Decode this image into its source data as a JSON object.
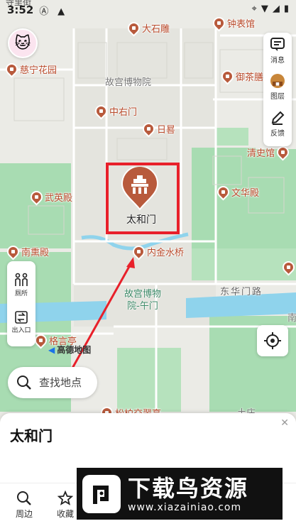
{
  "status_bar": {
    "time": "3:52",
    "cut_text": "寺里街"
  },
  "map": {
    "pois": [
      {
        "name": "大石雕",
        "id": "poi-dashidiao"
      },
      {
        "name": "钟表馆",
        "id": "poi-zhongbiaoguan"
      },
      {
        "name": "慈宁花园",
        "id": "poi-ciningguyuan"
      },
      {
        "name": "御茶膳房",
        "id": "poi-yuchashanfang"
      },
      {
        "name": "中右门",
        "id": "poi-zhongyoumen"
      },
      {
        "name": "日晷",
        "id": "poi-rigui"
      },
      {
        "name": "清史馆",
        "id": "poi-qingshiguan"
      },
      {
        "name": "武英殿",
        "id": "poi-wuyingdian"
      },
      {
        "name": "文华殿",
        "id": "poi-wenhuadian"
      },
      {
        "name": "南熏殿",
        "id": "poi-nanxundian"
      },
      {
        "name": "内金水桥",
        "id": "poi-neijinshuiqiao"
      },
      {
        "name": "格言亭",
        "id": "poi-geyanting"
      },
      {
        "name": "松柏交翠亭",
        "id": "poi-songbai"
      }
    ],
    "area_labels": {
      "museum_top": "故宫博物院",
      "museum_gate_line1": "故宫博物",
      "museum_gate_line2": "院-午门",
      "shoulder": "土庄",
      "nan": "南"
    },
    "road_label": "东华门路",
    "selected": {
      "name": "太和门"
    }
  },
  "avatar_icon": "hello-kitty-avatar",
  "right_panel": {
    "message": "消息",
    "layers": "图层",
    "feedback": "反馈"
  },
  "left_panel": {
    "toilet": "厕所",
    "entrance": "出入口"
  },
  "amap_logo": "高德地图",
  "search": {
    "placeholder": "查找地点"
  },
  "sheet": {
    "title": "太和门"
  },
  "bottom_nav": {
    "nearby": "周边",
    "favorite": "收藏"
  },
  "watermark": {
    "title": "下载鸟资源",
    "url": "www.xiazainiao.com"
  },
  "colors": {
    "highlight": "#e8202a",
    "poi_pin": "#b85a3c",
    "park_green": "#a8dcb2",
    "water_blue": "#8fd3ec"
  }
}
